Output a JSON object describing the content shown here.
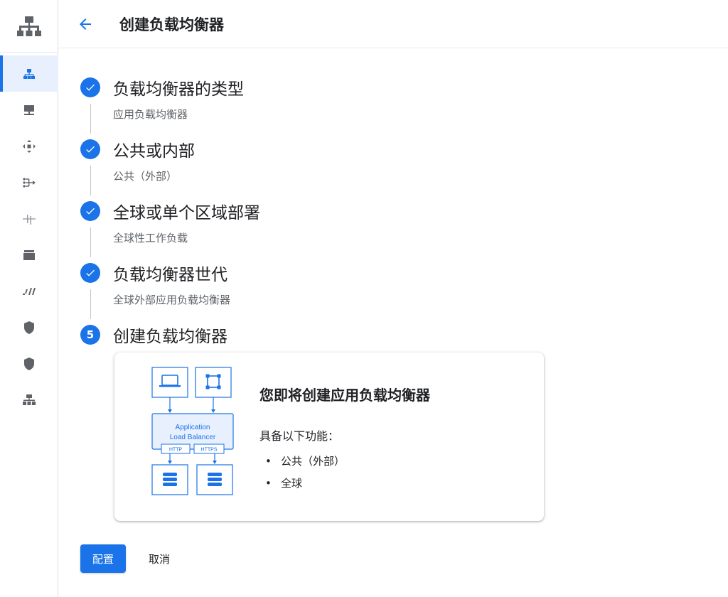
{
  "header": {
    "title": "创建负载均衡器",
    "back_icon": "arrow-back-icon"
  },
  "rail": {
    "logo_icon": "network-services-icon",
    "items": [
      {
        "icon": "load-balancing-icon",
        "active": true
      },
      {
        "icon": "cloud-dns-icon"
      },
      {
        "icon": "cloud-cdn-icon"
      },
      {
        "icon": "traffic-director-icon"
      },
      {
        "icon": "service-directory-icon"
      },
      {
        "icon": "cloud-domains-icon"
      },
      {
        "icon": "private-service-connect-icon"
      },
      {
        "icon": "secure-web-proxy-icon"
      },
      {
        "icon": "cloud-armor-icon"
      },
      {
        "icon": "service-mesh-icon"
      }
    ]
  },
  "steps": [
    {
      "title": "负载均衡器的类型",
      "subtitle": "应用负载均衡器",
      "state": "done"
    },
    {
      "title": "公共或内部",
      "subtitle": "公共（外部）",
      "state": "done"
    },
    {
      "title": "全球或单个区域部署",
      "subtitle": "全球性工作负载",
      "state": "done"
    },
    {
      "title": "负载均衡器世代",
      "subtitle": "全球外部应用负载均衡器",
      "state": "done"
    },
    {
      "title": "创建负载均衡器",
      "number": "5",
      "state": "current"
    }
  ],
  "card": {
    "title": "您即将创建应用负载均衡器",
    "features_label": "具备以下功能：",
    "features": [
      "公共（外部）",
      "全球"
    ],
    "diagram": {
      "line1": "Application",
      "line2": "Load Balancer",
      "port1": "HTTP",
      "port2": "HTTPS"
    },
    "accent": "#1a73e8"
  },
  "actions": {
    "configure": "配置",
    "cancel": "取消"
  }
}
